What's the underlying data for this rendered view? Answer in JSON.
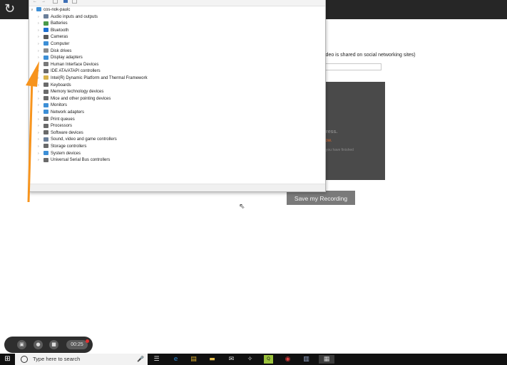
{
  "browser": {
    "refresh_icon": "refresh-icon"
  },
  "page": {
    "hint_text": "ideo is shared on social networking sites)",
    "input_value": "",
    "panel_line1": "ress.",
    "panel_line2": "low.",
    "panel_line3": "you have finished",
    "save_button": "Save my Recording"
  },
  "device_manager": {
    "root": "cos-nok-paulc",
    "items": [
      {
        "label": "Audio inputs and outputs",
        "icon": "speaker-icon",
        "color": "#6a7f9a"
      },
      {
        "label": "Batteries",
        "icon": "battery-icon",
        "color": "#4a9a4a"
      },
      {
        "label": "Bluetooth",
        "icon": "bluetooth-icon",
        "color": "#1e6fd0"
      },
      {
        "label": "Cameras",
        "icon": "camera-icon",
        "color": "#5a5a5a"
      },
      {
        "label": "Computer",
        "icon": "computer-icon",
        "color": "#3d8fd6"
      },
      {
        "label": "Disk drives",
        "icon": "disk-drive-icon",
        "color": "#8a8a8a"
      },
      {
        "label": "Display adapters",
        "icon": "display-adapter-icon",
        "color": "#3d8fd6"
      },
      {
        "label": "Human Interface Devices",
        "icon": "hid-icon",
        "color": "#7a7a7a"
      },
      {
        "label": "IDE ATA/ATAPI controllers",
        "icon": "ide-controller-icon",
        "color": "#6a6a6a"
      },
      {
        "label": "Intel(R) Dynamic Platform and Thermal Framework",
        "icon": "folder-icon",
        "color": "#d9b24a"
      },
      {
        "label": "Keyboards",
        "icon": "keyboard-icon",
        "color": "#6a6a6a"
      },
      {
        "label": "Memory technology devices",
        "icon": "memory-icon",
        "color": "#6a6a6a"
      },
      {
        "label": "Mice and other pointing devices",
        "icon": "mouse-icon",
        "color": "#6a6a6a"
      },
      {
        "label": "Monitors",
        "icon": "monitor-icon",
        "color": "#3d8fd6"
      },
      {
        "label": "Network adapters",
        "icon": "network-adapter-icon",
        "color": "#3d8fd6"
      },
      {
        "label": "Print queues",
        "icon": "printer-icon",
        "color": "#6a6a6a"
      },
      {
        "label": "Processors",
        "icon": "processor-icon",
        "color": "#6a6a6a"
      },
      {
        "label": "Software devices",
        "icon": "software-device-icon",
        "color": "#6a6a6a"
      },
      {
        "label": "Sound, video and game controllers",
        "icon": "sound-icon",
        "color": "#6a7f9a"
      },
      {
        "label": "Storage controllers",
        "icon": "storage-controller-icon",
        "color": "#6a6a6a"
      },
      {
        "label": "System devices",
        "icon": "system-device-icon",
        "color": "#3d8fd6"
      },
      {
        "label": "Universal Serial Bus controllers",
        "icon": "usb-icon",
        "color": "#6a6a6a"
      }
    ]
  },
  "recorder": {
    "time": "00:25"
  },
  "taskbar": {
    "search_placeholder": "Type here to search",
    "apps": [
      "task-view-icon",
      "edge-icon",
      "store-icon",
      "file-explorer-icon",
      "mail-icon",
      "app-icon",
      "terminal-icon",
      "chrome-icon",
      "notepad-icon",
      "network-app-icon"
    ]
  },
  "colors": {
    "accent_arrow": "#f7941d",
    "save_button_bg": "#7a7a7a",
    "topbar": "#262626"
  }
}
